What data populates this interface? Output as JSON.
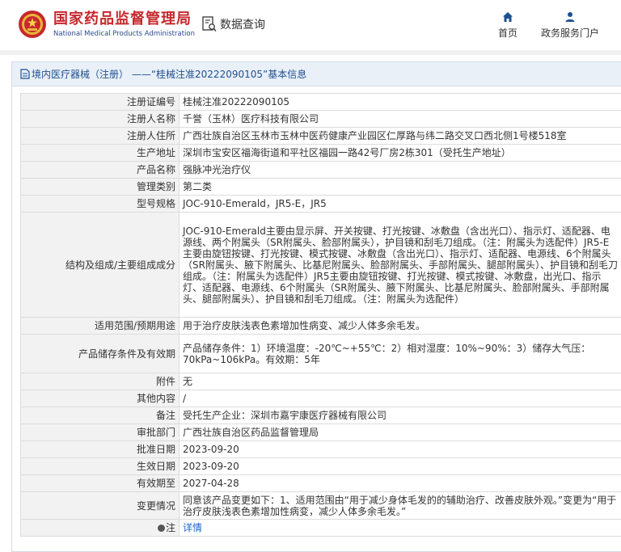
{
  "header": {
    "brand_cn": "国家药品监督管理局",
    "brand_en": "National Medical Products Administration",
    "db_search": "数据查询",
    "nav": [
      {
        "label": "首页",
        "icon": "home-icon"
      },
      {
        "label": "政务服务门户",
        "icon": "user-icon"
      }
    ],
    "colors": {
      "brand_red": "#c6282d",
      "brand_blue": "#2a4b8f",
      "link": "#1a63c6"
    }
  },
  "panel": {
    "title": "境内医疗器械（注册） ——“桂械注准20222090105”基本信息"
  },
  "rows": [
    {
      "label": "注册证编号",
      "value": "桂械注准20222090105"
    },
    {
      "label": "注册人名称",
      "value": "千誉（玉林）医疗科技有限公司"
    },
    {
      "label": "注册人住所",
      "value": "广西壮族自治区玉林市玉林中医药健康产业园区仁厚路与纬二路交叉口西北侧1号楼518室"
    },
    {
      "label": "生产地址",
      "value": "深圳市宝安区福海街道和平社区福园一路42号厂房2栋301（受托生产地址）"
    },
    {
      "label": "产品名称",
      "value": "强脉冲光治疗仪"
    },
    {
      "label": "管理类别",
      "value": "第二类"
    },
    {
      "label": "型号规格",
      "value": "JOC-910-Emerald，JR5-E，JR5"
    },
    {
      "label": "结构及组成/主要组成成分",
      "value": "JOC-910-Emerald主要由显示屏、开关按键、打光按键、冰敷盘（含出光口）、指示灯、适配器、电源线、两个附属头（SR附属头、脸部附属头），护目镜和刮毛刀组成。（注：附属头为选配件）JR5-E主要由旋钮按键、打光按键、模式按键、冰敷盘（含出光口）、指示灯、适配器、电源线、6个附属头（SR附属头、腋下附属头、比基尼附属头、脸部附属头、手部附属头、腿部附属头）、护目镜和刮毛刀组成。（注：附属头为选配件）JR5主要由旋钮按键、打光按键、模式按键、冰敷盘，出光口、指示灯、适配器、电源线、6个附属头（SR附属头、腋下附属头、比基尼附属头、脸部附属头、手部附属头、腿部附属头）、护目镜和刮毛刀组成。（注：附属头为选配件）"
    },
    {
      "label": "适用范围/预期用途",
      "value": "用于治疗皮肤浅表色素增加性病变、减少人体多余毛发。"
    },
    {
      "label": "产品储存条件及有效期",
      "value": "产品储存条件：1）环境温度：-20℃~+55℃：2）相对湿度：10%~90%：3）储存大气压：70kPa~106kPa。有效期：5年"
    },
    {
      "label": "附件",
      "value": "无"
    },
    {
      "label": "其他内容",
      "value": "/"
    },
    {
      "label": "备注",
      "value": "受托生产企业：深圳市嘉宇康医疗器械有限公司"
    },
    {
      "label": "审批部门",
      "value": "广西壮族自治区药品监督管理局"
    },
    {
      "label": "批准日期",
      "value": "2023-09-20"
    },
    {
      "label": "生效日期",
      "value": "2023-09-20"
    },
    {
      "label": "有效期至",
      "value": "2027-04-28"
    },
    {
      "label": "变更情况",
      "value": "同意该产品变更如下：1、适用范围由“用于减少身体毛发的的辅助治疗、改善皮肤外观。”变更为“用于治疗皮肤浅表色素增加性病变，减少人体多余毛发。”"
    },
    {
      "label": "注",
      "value": "详情"
    }
  ]
}
